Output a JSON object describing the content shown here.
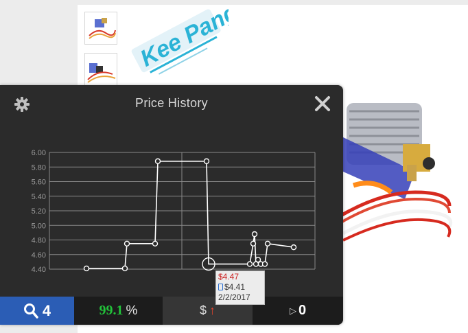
{
  "widget": {
    "title": "Price History",
    "tooltip": {
      "current_price": "$4.47",
      "lowest_price": "$4.41",
      "date": "2/2/2017"
    },
    "bottom_bar": {
      "search_count": "4",
      "rating_value": "99.1",
      "rating_unit": "%",
      "price_symbol": "$",
      "price_trend": "↑",
      "views_count": "0"
    }
  },
  "chart_data": {
    "type": "line",
    "ylim": [
      4.4,
      6.0
    ],
    "y_ticks": [
      "6.00",
      "5.80",
      "5.60",
      "5.40",
      "5.20",
      "5.00",
      "4.80",
      "4.60",
      "4.40"
    ],
    "series": [
      {
        "values": [
          4.41,
          4.41,
          4.75,
          4.75,
          5.88,
          5.88,
          4.47,
          4.47,
          4.75,
          4.88,
          4.47,
          4.53,
          4.47,
          4.47,
          4.75,
          4.7
        ]
      }
    ],
    "highlight_index": 6,
    "colors": {
      "line": "#ffffff",
      "grid": "#8a8a8a",
      "background": "#2b2b2b"
    }
  }
}
